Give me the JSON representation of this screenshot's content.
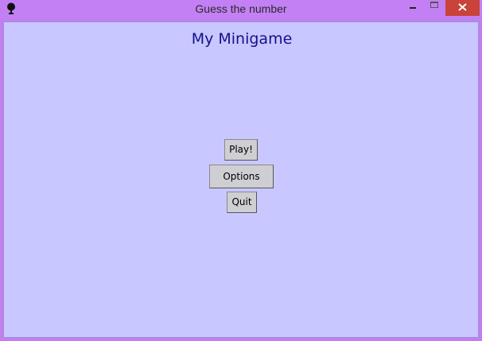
{
  "window": {
    "title": "Guess the number",
    "icons": {
      "app": "tk-feather-icon",
      "minimize": "minimize-icon",
      "maximize": "maximize-icon",
      "close": "close-icon"
    },
    "colors": {
      "frame": "#c17ff0",
      "close_button": "#c9433a"
    }
  },
  "app": {
    "heading": "My Minigame",
    "background": "#c9c7ff",
    "buttons": {
      "play": "Play!",
      "options": "Options",
      "quit": "Quit"
    }
  }
}
